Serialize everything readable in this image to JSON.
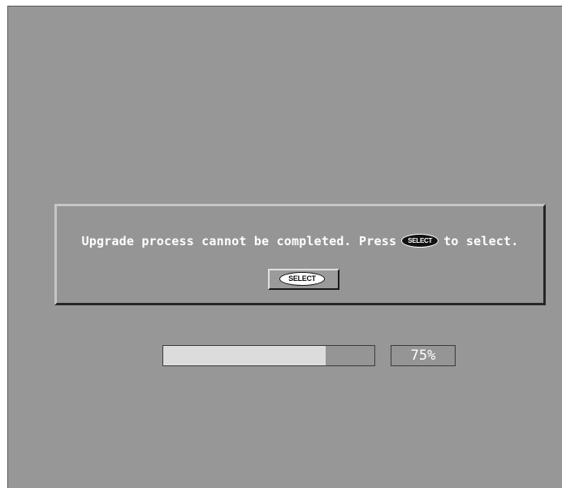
{
  "dialog": {
    "message_before": "Upgrade process cannot be completed. Press",
    "message_key": "SELECT",
    "message_after": "to select.",
    "button_label": "SELECT"
  },
  "progress": {
    "percent_label": "75%",
    "fraction": 0.77
  }
}
